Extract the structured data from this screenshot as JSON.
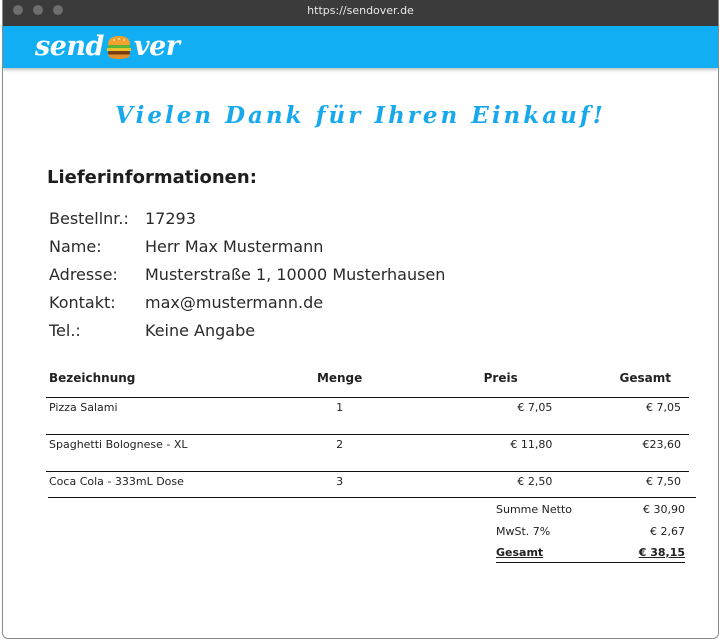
{
  "browser": {
    "url": "https://sendover.de"
  },
  "brand": {
    "logo_left": "send",
    "logo_right": "ver",
    "color": "#12aef4"
  },
  "heading": {
    "thanks": "Vielen Dank für Ihren Einkauf!"
  },
  "delivery": {
    "title": "Lieferinformationen:",
    "rows": [
      {
        "label": "Bestellnr.:",
        "value": "17293"
      },
      {
        "label": "Name:",
        "value": "Herr Max Mustermann"
      },
      {
        "label": "Adresse:",
        "value": "Musterstraße 1, 10000 Musterhausen"
      },
      {
        "label": "Kontakt:",
        "value": "max@mustermann.de"
      },
      {
        "label": "Tel.:",
        "value": "Keine Angabe"
      }
    ]
  },
  "items_table": {
    "headers": {
      "name": "Bezeichnung",
      "qty": "Menge",
      "price": "Preis",
      "total": "Gesamt"
    },
    "rows": [
      {
        "name": "Pizza Salami",
        "qty": "1",
        "price": "€ 7,05",
        "total": "€ 7,05"
      },
      {
        "name": "Spaghetti Bolognese - XL",
        "qty": "2",
        "price": "€ 11,80",
        "total": "€23,60"
      },
      {
        "name": "Coca Cola - 333mL Dose",
        "qty": "3",
        "price": "€ 2,50",
        "total": "€ 7,50"
      }
    ]
  },
  "totals": {
    "net_label": "Summe Netto",
    "net_value": "€ 30,90",
    "vat_label": "MwSt. 7%",
    "vat_value": "€ 2,67",
    "grand_label": "Gesamt",
    "grand_value": "€ 38,15"
  }
}
